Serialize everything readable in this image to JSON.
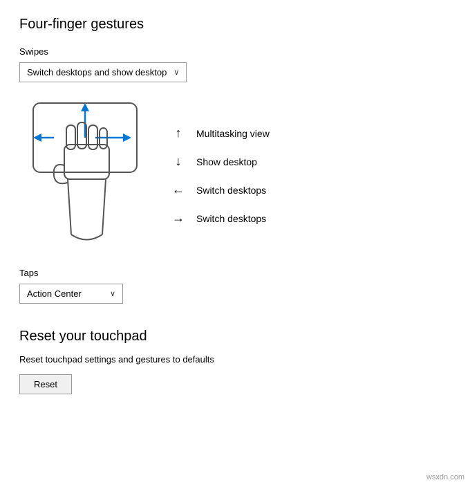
{
  "page": {
    "main_title": "Four-finger gestures",
    "swipes_label": "Swipes",
    "swipes_dropdown_value": "Switch desktops and show desktop",
    "swipes_dropdown_arrow": "∨",
    "gesture_items": [
      {
        "arrow": "↑",
        "label": "Multitasking view"
      },
      {
        "arrow": "↓",
        "label": "Show desktop"
      },
      {
        "arrow": "←",
        "label": "Switch desktops"
      },
      {
        "arrow": "→",
        "label": "Switch desktops"
      }
    ],
    "taps_label": "Taps",
    "taps_dropdown_value": "Action Center",
    "taps_dropdown_arrow": "∨",
    "reset_section": {
      "title": "Reset your touchpad",
      "description": "Reset touchpad settings and gestures to defaults",
      "button_label": "Reset"
    },
    "watermark": "wsxdn.com"
  }
}
